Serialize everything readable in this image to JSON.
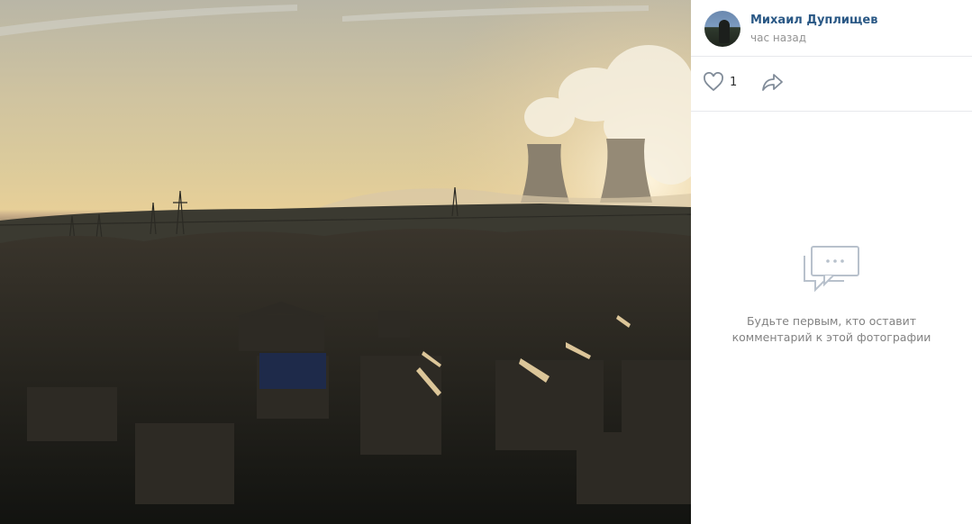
{
  "photo": {
    "alt_icon": "photo-image"
  },
  "post": {
    "author_name": "Михаил Дуплищев",
    "time": "час назад",
    "avatar_icon": "avatar-image"
  },
  "actions": {
    "like_count": "1",
    "like_icon": "heart-icon",
    "share_icon": "share-arrow-icon"
  },
  "comments": {
    "empty_line1": "Будьте первым, кто оставит",
    "empty_line2": "комментарий к этой фотографии",
    "empty_icon": "comment-bubble-icon"
  },
  "colors": {
    "link": "#2a5885",
    "muted": "#939393",
    "divider": "#e7e8ec"
  }
}
